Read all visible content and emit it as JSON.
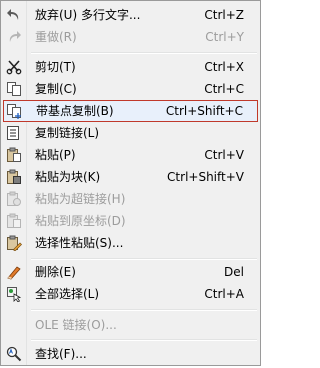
{
  "menu": {
    "items": [
      {
        "label": "放弃(U) 多行文字...",
        "shortcut": "Ctrl+Z",
        "icon": "undo-icon"
      },
      {
        "label": "重做(R)",
        "shortcut": "Ctrl+Y",
        "icon": "redo-icon"
      },
      {
        "label": "剪切(T)",
        "shortcut": "Ctrl+X",
        "icon": "scissors-icon"
      },
      {
        "label": "复制(C)",
        "shortcut": "Ctrl+C",
        "icon": "copy-icon"
      },
      {
        "label": "带基点复制(B)",
        "shortcut": "Ctrl+Shift+C",
        "icon": "copy-basepoint-icon"
      },
      {
        "label": "复制链接(L)",
        "shortcut": "",
        "icon": "copy-link-icon"
      },
      {
        "label": "粘贴(P)",
        "shortcut": "Ctrl+V",
        "icon": "paste-icon"
      },
      {
        "label": "粘贴为块(K)",
        "shortcut": "Ctrl+Shift+V",
        "icon": "paste-block-icon"
      },
      {
        "label": "粘贴为超链接(H)",
        "shortcut": "",
        "icon": "paste-hyperlink-icon"
      },
      {
        "label": "粘贴到原坐标(D)",
        "shortcut": "",
        "icon": "paste-original-coords-icon"
      },
      {
        "label": "选择性粘贴(S)...",
        "shortcut": "",
        "icon": "paste-special-icon"
      },
      {
        "label": "删除(E)",
        "shortcut": "Del",
        "icon": "eraser-icon"
      },
      {
        "label": "全部选择(L)",
        "shortcut": "Ctrl+A",
        "icon": "select-all-icon"
      },
      {
        "label": "OLE 链接(O)...",
        "shortcut": "",
        "icon": ""
      },
      {
        "label": "查找(F)...",
        "shortcut": "",
        "icon": "find-abc-icon"
      }
    ]
  }
}
